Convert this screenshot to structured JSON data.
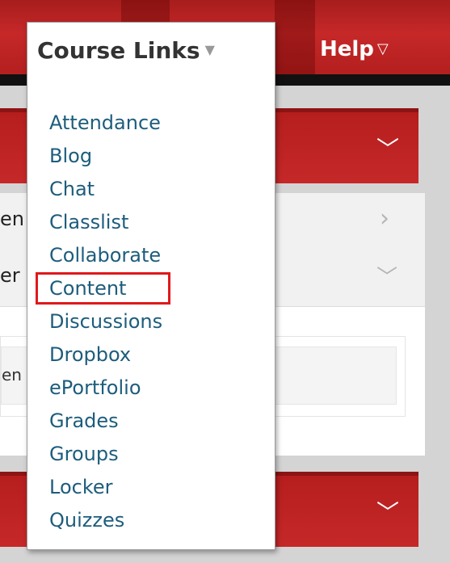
{
  "navbar": {
    "course_links_label": "Course Links",
    "help_label": "Help",
    "caret_icon": "caret-down-icon"
  },
  "background": {
    "row_fragments": [
      "en",
      "er"
    ],
    "inner_fragment": "en"
  },
  "course_links_menu": {
    "items": [
      "Attendance",
      "Blog",
      "Chat",
      "Classlist",
      "Collaborate",
      "Content",
      "Discussions",
      "Dropbox",
      "ePortfolio",
      "Grades",
      "Groups",
      "Locker",
      "Quizzes"
    ],
    "highlighted_item": "Content"
  },
  "colors": {
    "brand_red": "#c62828",
    "link_blue": "#1d5d7c",
    "highlight_box": "#e0191b"
  }
}
